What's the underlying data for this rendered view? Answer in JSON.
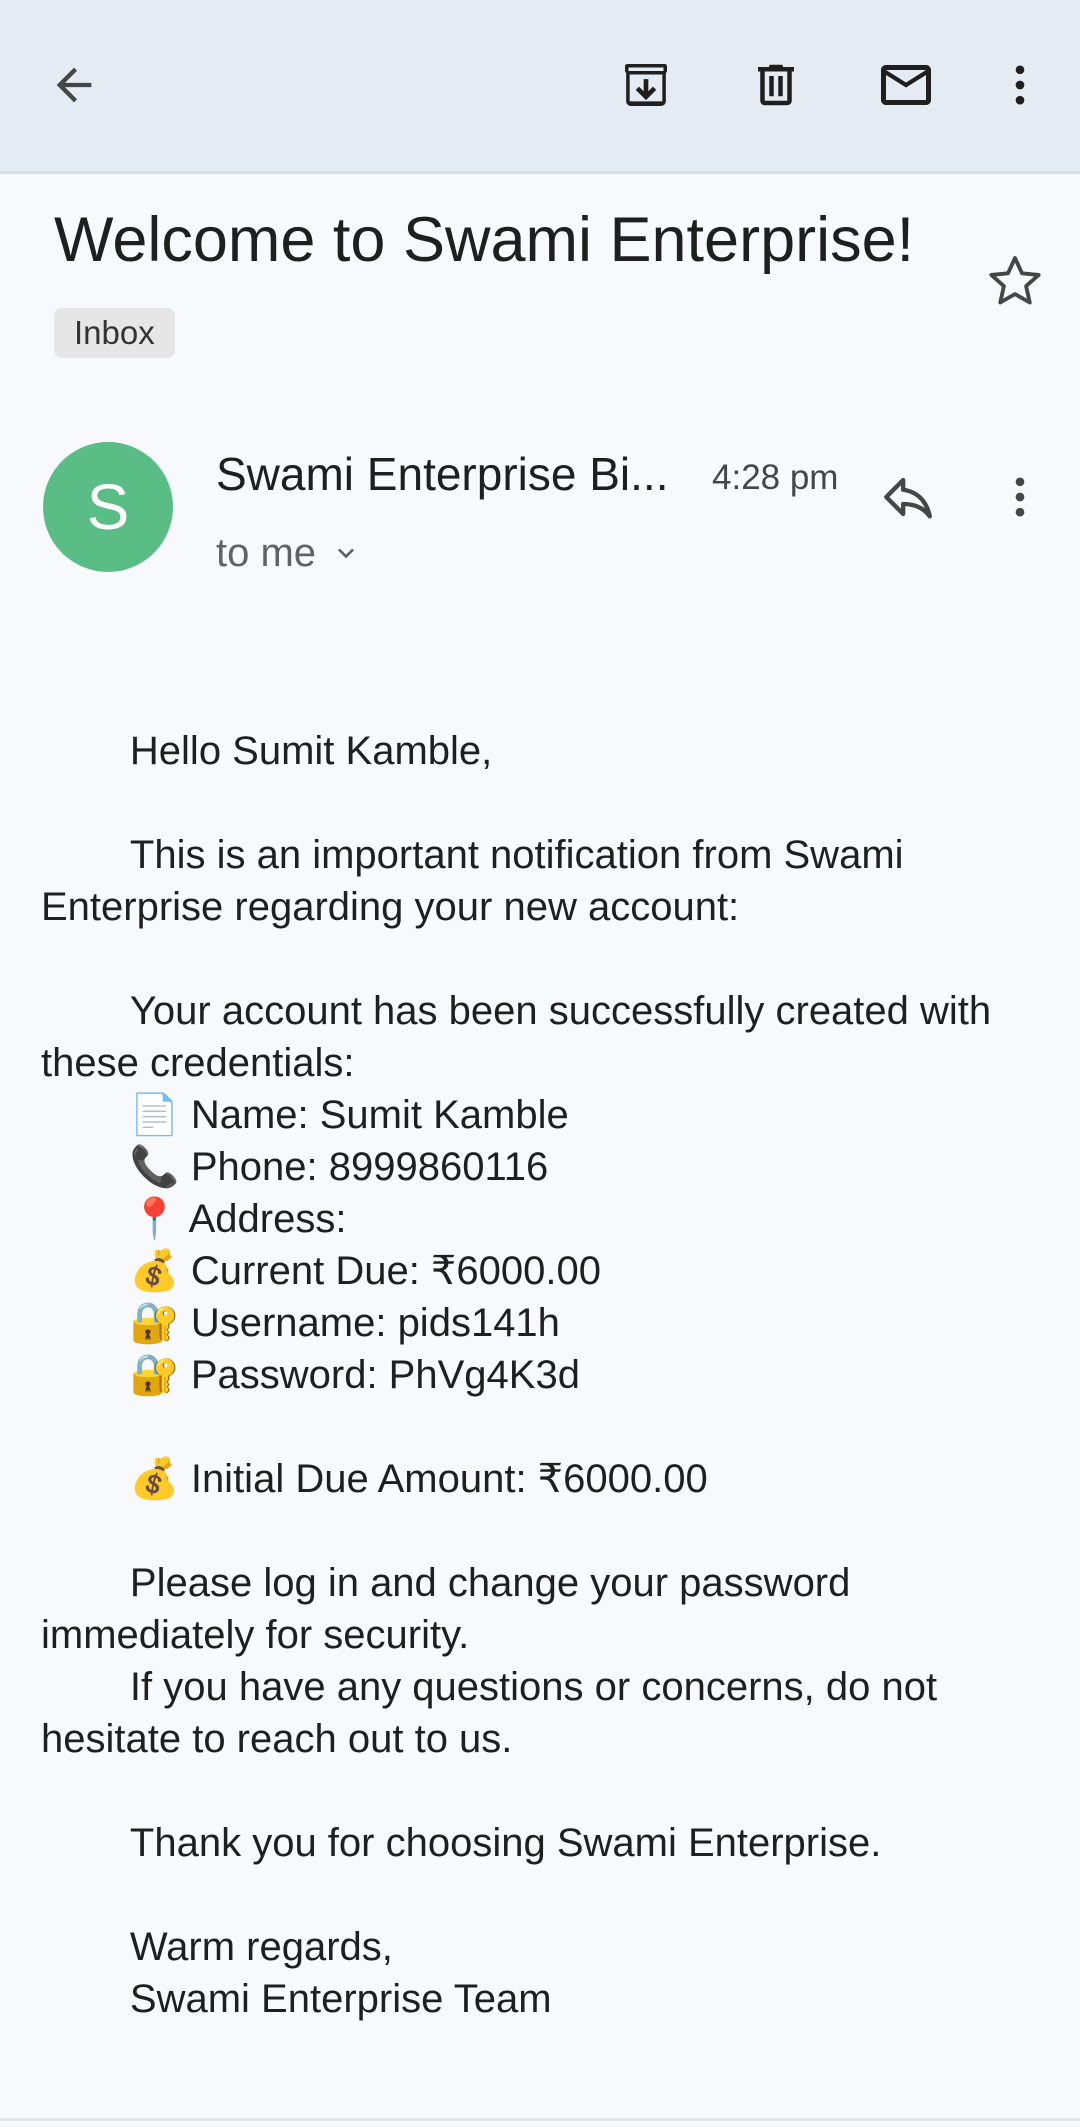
{
  "toolbar": {
    "back_icon": "arrow-back-icon",
    "archive_icon": "archive-icon",
    "delete_icon": "trash-icon",
    "mark_unread_icon": "mail-icon",
    "more_icon": "more-vert-icon"
  },
  "email": {
    "subject": "Welcome to Swami Enterprise!",
    "label": "Inbox",
    "starred": false,
    "sender_initial": "S",
    "sender_name": "Swami Enterprise Bi...",
    "time": "4:28 pm",
    "recipient": "to me",
    "avatar_color": "#5bbd86",
    "body": "        Hello Sumit Kamble,\n\n        This is an important notification from Swami Enterprise regarding your new account:\n\n        Your account has been successfully created with these credentials:\n        📄 Name: Sumit Kamble\n        📞 Phone: 8999860116\n        📍 Address: \n        💰 Current Due: ₹6000.00\n        🔐 Username: pids141h\n        🔐 Password: PhVg4K3d\n\n        💰 Initial Due Amount: ₹6000.00\n\n        Please log in and change your password immediately for security.\n        If you have any questions or concerns, do not hesitate to reach out to us.\n\n        Thank you for choosing Swami Enterprise.\n\n        Warm regards,\n        Swami Enterprise Team"
  },
  "colors": {
    "appbar_bg": "#e5ebf3",
    "page_bg": "#f8f9fd",
    "avatar": "#5bbd86"
  }
}
